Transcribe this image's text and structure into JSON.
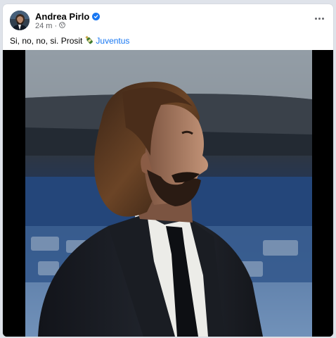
{
  "post": {
    "author": "Andrea Pirlo",
    "timestamp": "24 m",
    "visibility_icon": "globe-icon",
    "verified_icon": "verified-badge-icon",
    "more_icon": "more-options-icon",
    "caption_text": "Si, no, no, si. Prosit",
    "caption_emoji": "bottle-emoji",
    "hashtag": "Juventus"
  },
  "colors": {
    "link": "#1877f2",
    "meta": "#65676b",
    "text": "#050505"
  }
}
